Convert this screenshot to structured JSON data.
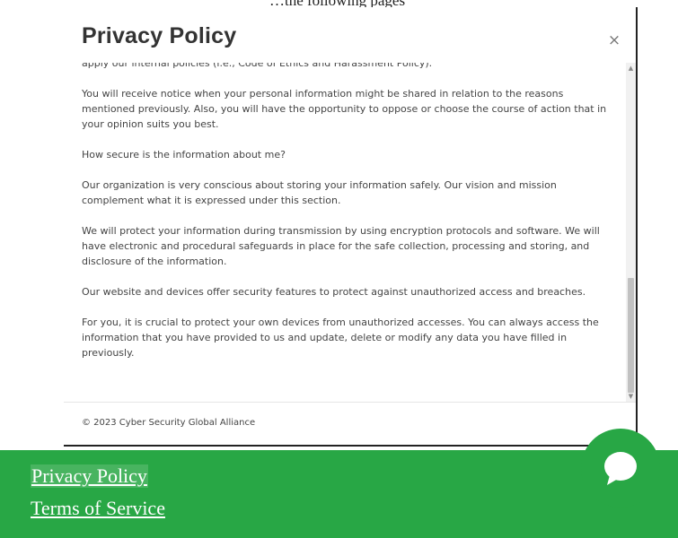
{
  "top_clip_text": "…the following pages",
  "modal": {
    "title": "Privacy Policy",
    "close_label": "×",
    "paragraphs": [
      "apply our internal policies (i.e., Code of Ethics and Harassment Policy).",
      "You will receive notice when your personal information might be shared in relation to the reasons mentioned previously. Also, you will have the opportunity to oppose or choose the course of action that in your opinion suits you best.",
      "How secure is the information about me?",
      "Our organization is very conscious about storing your information safely. Our vision and mission complement what it is expressed under this section.",
      "We will protect your information during transmission by using encryption protocols and software. We will have electronic and procedural safeguards in place for the safe collection, processing and storing, and disclosure of the information.",
      "Our website and devices offer security features to protect against unauthorized access and breaches.",
      "For you, it is crucial to protect your own devices from unauthorized accesses. You can always access the information that you have provided to us and update, delete or modify any data you have filled in previously."
    ],
    "footer_text": "© 2023 Cyber Security Global Alliance"
  },
  "page_footer": {
    "links": [
      "Privacy Policy",
      "Terms of Service"
    ],
    "background_color": "#28a745"
  },
  "icons": {
    "close": "close-icon",
    "chat": "chat-bubble-icon",
    "scroll_up": "scroll-up-arrow-icon",
    "scroll_down": "scroll-down-arrow-icon"
  }
}
